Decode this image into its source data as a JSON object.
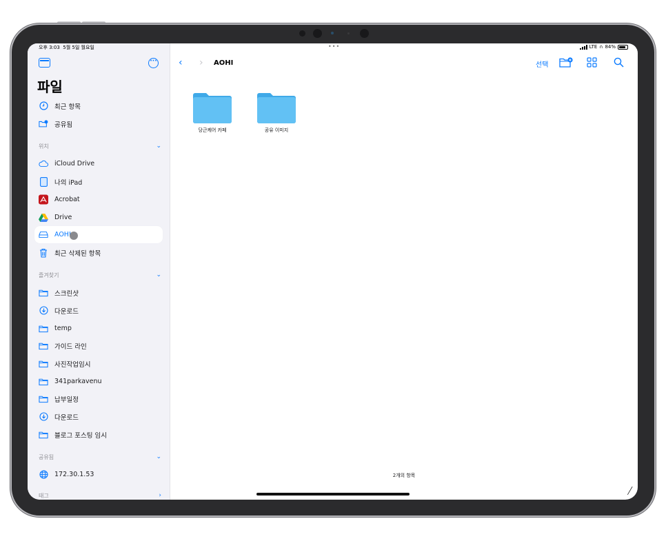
{
  "status": {
    "time": "오후 3:03",
    "date": "5월 5일 월요일",
    "dots": "•••",
    "network": "LTE",
    "battery": "84%"
  },
  "sidebar": {
    "title": "파일",
    "top_items": [
      {
        "label": "최근 항목",
        "icon": "clock-icon"
      },
      {
        "label": "공유됨",
        "icon": "shared-folder-icon"
      }
    ],
    "locations_header": "위치",
    "locations": [
      {
        "label": "iCloud Drive",
        "icon": "cloud-icon"
      },
      {
        "label": "나의 iPad",
        "icon": "ipad-icon"
      },
      {
        "label": "Acrobat",
        "icon": "acrobat-icon"
      },
      {
        "label": "Drive",
        "icon": "google-drive-icon"
      },
      {
        "label": "AOHI",
        "icon": "drive-disk-icon",
        "selected": true
      },
      {
        "label": "최근 삭제된 항목",
        "icon": "trash-icon"
      }
    ],
    "favorites_header": "즐겨찾기",
    "favorites": [
      {
        "label": "스크린샷",
        "icon": "folder-icon"
      },
      {
        "label": "다운로드",
        "icon": "download-icon"
      },
      {
        "label": "temp",
        "icon": "folder-icon"
      },
      {
        "label": "가이드 라인",
        "icon": "folder-icon"
      },
      {
        "label": "사진작업임시",
        "icon": "folder-icon"
      },
      {
        "label": "341parkavenu",
        "icon": "folder-icon"
      },
      {
        "label": "납부일정",
        "icon": "folder-icon"
      },
      {
        "label": "다운로드",
        "icon": "download-icon"
      },
      {
        "label": "블로그 포스팅 임시",
        "icon": "folder-icon"
      }
    ],
    "shared_header": "공유됨",
    "shared": [
      {
        "label": "172.30.1.53",
        "icon": "globe-icon"
      }
    ],
    "tags_header": "태그"
  },
  "main": {
    "title": "AOHI",
    "select_label": "선택",
    "folders": [
      {
        "label": "당근케어 카페"
      },
      {
        "label": "공유 이미지"
      }
    ],
    "item_count": "2개의 항목"
  },
  "colors": {
    "accent": "#0a7aff",
    "folder": "#5ac0f5",
    "sidebar_bg": "#f2f2f7"
  }
}
